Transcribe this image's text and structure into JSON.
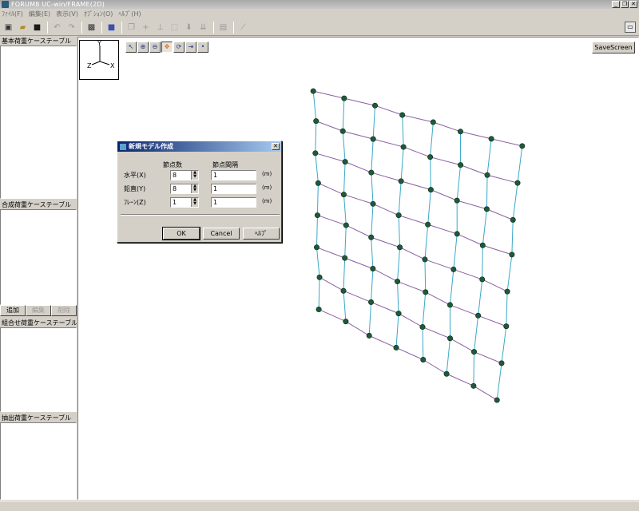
{
  "window": {
    "title": "FORUM8 UC-win/FRAME(2D)",
    "controls": [
      "_",
      "❐",
      "✕"
    ]
  },
  "menu": [
    "ﾌｧｲﾙ(F)",
    "編集(E)",
    "表示(V)",
    "ｵﾌﾟｼｮﾝ(O)",
    "ﾍﾙﾌﾟ(H)"
  ],
  "panels": {
    "basic_load_table": "基本荷重ケーステーブル",
    "composite_load_table": "合成荷重ケーステーブル",
    "combination_load_table": "組合せ荷重ケーステーブル",
    "extracted_load_table": "抽出荷重ケーステーブル",
    "buttons": {
      "add": "追加",
      "edit": "編集",
      "delete": "削除"
    }
  },
  "viewport": {
    "save_screen": "SaveScreen",
    "axis": {
      "y": "Y",
      "x": "X",
      "z": "Z"
    }
  },
  "dialog": {
    "title": "新規モデル作成",
    "col_nodes": "節点数",
    "col_spacing": "節点間隔",
    "rows": [
      {
        "label": "水平(X)",
        "count": "8",
        "spacing": "1",
        "unit": "(m)"
      },
      {
        "label": "鉛直(Y)",
        "count": "8",
        "spacing": "1",
        "unit": "(m)"
      },
      {
        "label": "ﾌﾚｰﾝ(Z)",
        "count": "1",
        "spacing": "1",
        "unit": "(m)"
      }
    ],
    "ok": "OK",
    "cancel": "Cancel",
    "help": "ﾍﾙﾌﾟ"
  },
  "colors": {
    "node": "#1e5a3a",
    "member_h": "#8a5fa0",
    "member_v": "#3aa8c8"
  }
}
